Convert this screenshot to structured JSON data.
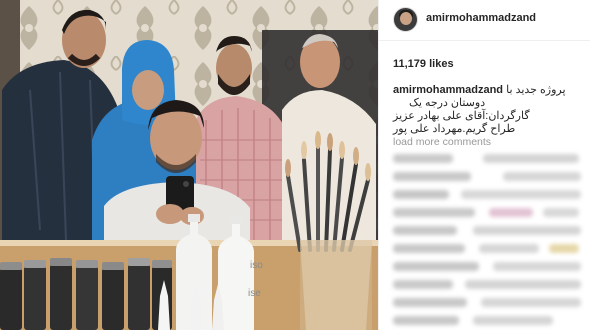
{
  "post": {
    "username": "amirmohammadzand",
    "likes": "11,179 likes",
    "caption": {
      "username": "amirmohammadzand",
      "line1": "پروژه جدید با",
      "line2": "دوستان درجه یک",
      "line3": "گارگردان:آقای علی بهادر عزیز",
      "line4": "طراح گریم.مهرداد علی پور"
    },
    "load_more": "load more comments"
  },
  "photo": {
    "bottle_labels": [
      "ise",
      "iso"
    ]
  }
}
